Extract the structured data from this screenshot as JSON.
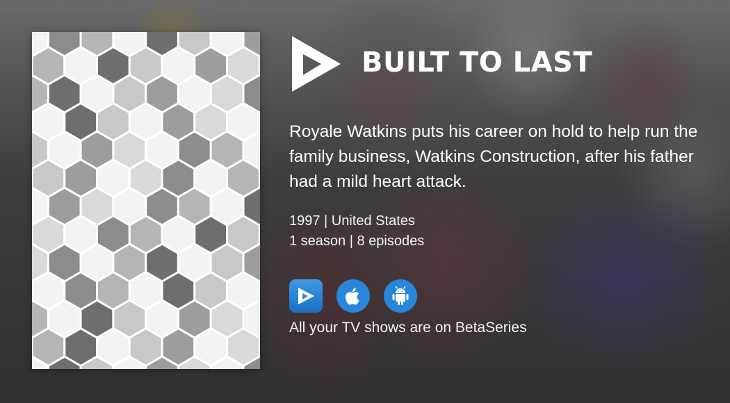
{
  "show": {
    "title": "BUILT TO LAST",
    "description": "Royale Watkins puts his career on hold to help run the family business, Watkins Construction, after his father had a mild heart attack.",
    "meta_line_1": "1997 | United States",
    "meta_line_2": "1 season | 8 episodes"
  },
  "brand": {
    "logo_icon": "betaseries-play-icon",
    "tagline": "All your TV shows are on BetaSeries"
  },
  "apps": [
    {
      "name": "betaseries-app-icon"
    },
    {
      "name": "apple-app-store-icon"
    },
    {
      "name": "android-play-store-icon"
    }
  ],
  "colors": {
    "accent_blue": "#2a86d8",
    "text": "#ffffff"
  }
}
